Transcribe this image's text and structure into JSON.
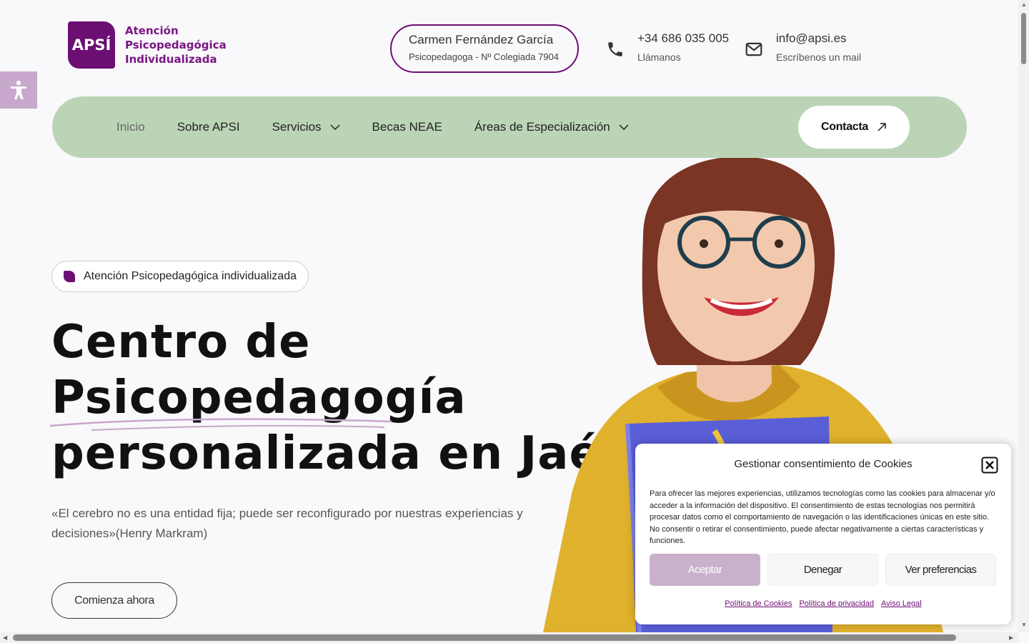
{
  "logo": {
    "mark": "APSÍ",
    "lines": [
      "Atención",
      "Psicopedagógica",
      "Individualizada"
    ]
  },
  "badge": {
    "name": "Carmen Fernández García",
    "role": "Psicopedagoga - Nº Colegiada 7904"
  },
  "contact": {
    "phone": "+34 686 035 005",
    "phone_sub": "Llámanos",
    "email": "info@apsi.es",
    "email_sub": "Escríbenos un mail"
  },
  "nav": {
    "items": [
      "Inicio",
      "Sobre APSI",
      "Servicios",
      "Becas NEAE",
      "Áreas de Especialización"
    ],
    "cta": "Contacta"
  },
  "hero": {
    "tag": "Atención Psicopedagógica individualizada",
    "title_1": "Centro de",
    "title_2": "Psicopedagogía",
    "title_3": "personalizada en Jaén",
    "quote": "«El cerebro no es una entidad fija; puede ser reconfigurado por nuestras experiencias y decisiones»(Henry Markram)",
    "cta": "Comienza ahora"
  },
  "cookie": {
    "title": "Gestionar consentimiento de Cookies",
    "text": "Para ofrecer las mejores experiencias, utilizamos tecnologías como las cookies para almacenar y/o acceder a la información del dispositivo. El consentimiento de estas tecnologías nos permitirá procesar datos como el comportamiento de navegación o las identificaciones únicas en este sitio. No consentir o retirar el consentimiento, puede afectar negativamente a ciertas características y funciones.",
    "accept": "Aceptar",
    "deny": "Denegar",
    "prefs": "Ver preferencias",
    "links": [
      "Política de Cookies",
      "Política de privacidad",
      "Aviso Legal"
    ]
  },
  "colors": {
    "brand": "#6c0f73",
    "nav_bg": "#bcd4b6",
    "accept_bg": "#c9b1cb"
  }
}
